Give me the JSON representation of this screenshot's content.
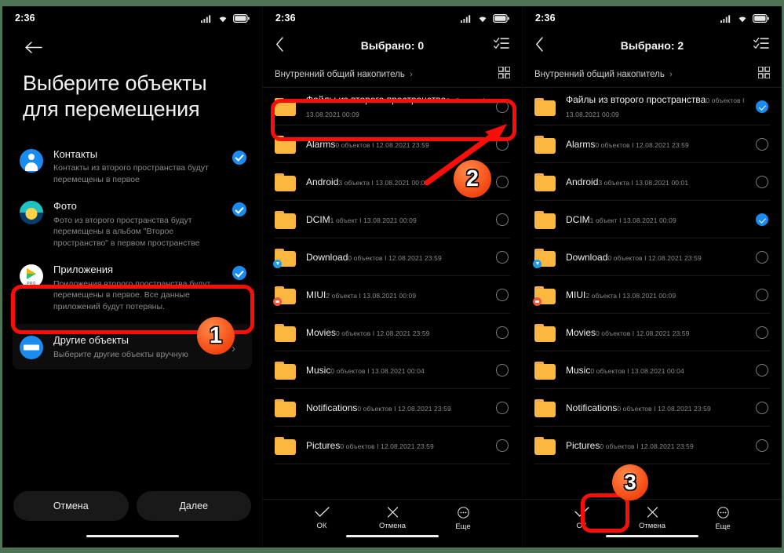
{
  "meta": {
    "status_time": "2:36",
    "accent_blue": "#1a8cf0",
    "folder_yellow": "#fbb73f",
    "annotation_red": "#fb0d09",
    "border_green": "#4d7256"
  },
  "panel1": {
    "name": "select-objects-to-move",
    "back_icon": "arrow-left-icon",
    "title": "Выберите объекты для перемещения",
    "options": [
      {
        "icon": "contacts-icon",
        "title": "Контакты",
        "subtitle": "Контакты из второго пространства будут перемещены в первое",
        "checked": true
      },
      {
        "icon": "photo-icon",
        "title": "Фото",
        "subtitle": "Фото из второго пространства будут перемещены в альбом \"Второе пространство\" в первом пространстве",
        "checked": true
      },
      {
        "icon": "apps-icon",
        "title": "Приложения",
        "subtitle": "Приложения второго пространства будут перемещены в первое. Все данные приложений будут потеряны.",
        "checked": true
      }
    ],
    "other": {
      "icon": "other-objects-icon",
      "title": "Другие объекты",
      "subtitle": "Выберите другие объекты вручную",
      "chevron": "chevron-right-icon"
    },
    "buttons": {
      "cancel": "Отмена",
      "next": "Далее"
    }
  },
  "panel2": {
    "name": "file-picker-none-selected",
    "back_icon": "chevron-left-icon",
    "title": "Выбрано: 0",
    "select_all_icon": "select-all-icon",
    "path": "Внутренний общий накопитель",
    "path_chevron": "chevron-right-icon",
    "grid_icon": "grid-view-icon",
    "rows": [
      {
        "name": "Файлы из второго пространства",
        "sub": "0 объектов I 13.08.2021 00:09",
        "badge": "none",
        "checked": false
      },
      {
        "name": "Alarms",
        "sub": "0 объектов I 12.08.2021 23:59",
        "badge": "none",
        "checked": false
      },
      {
        "name": "Android",
        "sub": "3 объекта I 13.08.2021 00:01",
        "badge": "none",
        "checked": false
      },
      {
        "name": "DCIM",
        "sub": "1 объект I 13.08.2021 00:09",
        "badge": "none",
        "checked": false
      },
      {
        "name": "Download",
        "sub": "0 объектов I 12.08.2021 23:59",
        "badge": "download",
        "checked": false
      },
      {
        "name": "MIUI",
        "sub": "2 объекта I 13.08.2021 00:09",
        "badge": "miui",
        "checked": false
      },
      {
        "name": "Movies",
        "sub": "0 объектов I 12.08.2021 23:59",
        "badge": "none",
        "checked": false
      },
      {
        "name": "Music",
        "sub": "0 объектов I 13.08.2021 00:04",
        "badge": "none",
        "checked": false
      },
      {
        "name": "Notifications",
        "sub": "0 объектов I 12.08.2021 23:59",
        "badge": "none",
        "checked": false
      },
      {
        "name": "Pictures",
        "sub": "0 объектов I 12.08.2021 23:59",
        "badge": "none",
        "checked": false
      }
    ],
    "actions": [
      {
        "icon": "check-icon",
        "label": "ОК"
      },
      {
        "icon": "close-icon",
        "label": "Отмена"
      },
      {
        "icon": "more-icon",
        "label": "Еще"
      }
    ]
  },
  "panel3": {
    "name": "file-picker-two-selected",
    "back_icon": "chevron-left-icon",
    "title": "Выбрано: 2",
    "select_all_icon": "select-all-icon",
    "path": "Внутренний общий накопитель",
    "path_chevron": "chevron-right-icon",
    "grid_icon": "grid-view-icon",
    "rows": [
      {
        "name": "Файлы из второго пространства",
        "sub": "0 объектов I 13.08.2021 00:09",
        "badge": "none",
        "checked": true
      },
      {
        "name": "Alarms",
        "sub": "0 объектов I 12.08.2021 23:59",
        "badge": "none",
        "checked": false
      },
      {
        "name": "Android",
        "sub": "3 объекта I 13.08.2021 00:01",
        "badge": "none",
        "checked": false
      },
      {
        "name": "DCIM",
        "sub": "1 объект I 13.08.2021 00:09",
        "badge": "none",
        "checked": true
      },
      {
        "name": "Download",
        "sub": "0 объектов I 12.08.2021 23:59",
        "badge": "download",
        "checked": false
      },
      {
        "name": "MIUI",
        "sub": "2 объекта I 13.08.2021 00:09",
        "badge": "miui",
        "checked": false
      },
      {
        "name": "Movies",
        "sub": "0 объектов I 12.08.2021 23:59",
        "badge": "none",
        "checked": false
      },
      {
        "name": "Music",
        "sub": "0 объектов I 13.08.2021 00:04",
        "badge": "none",
        "checked": false
      },
      {
        "name": "Notifications",
        "sub": "0 объектов I 12.08.2021 23:59",
        "badge": "none",
        "checked": false
      },
      {
        "name": "Pictures",
        "sub": "0 объектов I 12.08.2021 23:59",
        "badge": "none",
        "checked": false
      }
    ],
    "actions": [
      {
        "icon": "check-icon",
        "label": "ОК"
      },
      {
        "icon": "close-icon",
        "label": "Отмена"
      },
      {
        "icon": "more-icon",
        "label": "Еще"
      }
    ]
  },
  "annotations": {
    "step1": "1",
    "step2": "2",
    "step3": "3"
  }
}
